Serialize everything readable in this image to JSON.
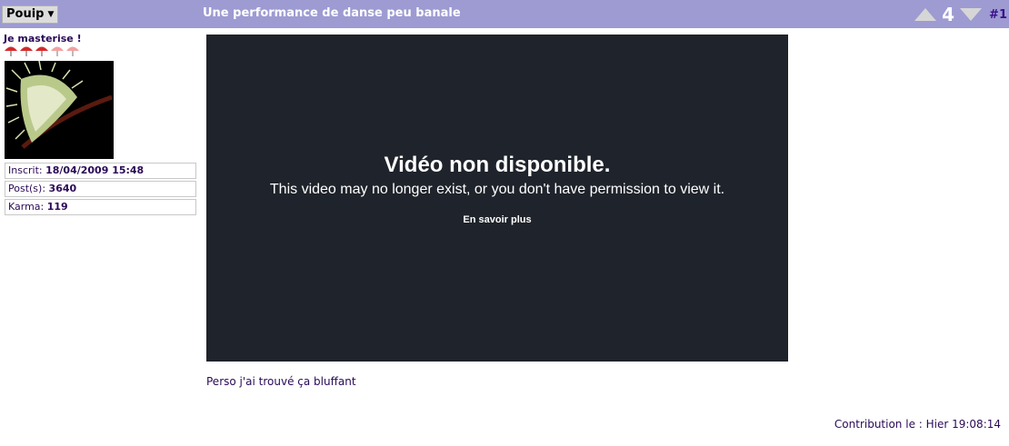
{
  "header": {
    "user_label": "Pouip",
    "caret": "▼",
    "topic_title": "Une performance de danse peu banale",
    "vote_count": "4",
    "post_number": "#1"
  },
  "author": {
    "rank": "Je masterise !",
    "rank_umbrellas": 5,
    "inscrit_label": "Inscrit: ",
    "inscrit_value": "18/04/2009 15:48",
    "posts_label": "Post(s): ",
    "posts_value": "3640",
    "karma_label": "Karma: ",
    "karma_value": "119"
  },
  "video": {
    "title": "Vidéo non disponible.",
    "message": "This video may no longer exist, or you don't have permission to view it.",
    "link": "En savoir plus"
  },
  "post": {
    "text": "Perso j'ai trouvé ça bluffant",
    "contribution": "Contribution le : Hier 19:08:14"
  },
  "colors": {
    "header_bg": "#9d9bd2",
    "text": "#2a0a57",
    "video_bg": "#1f232b",
    "umbrella_full": "#d42a2a",
    "umbrella_light": "#f2a0a0"
  }
}
